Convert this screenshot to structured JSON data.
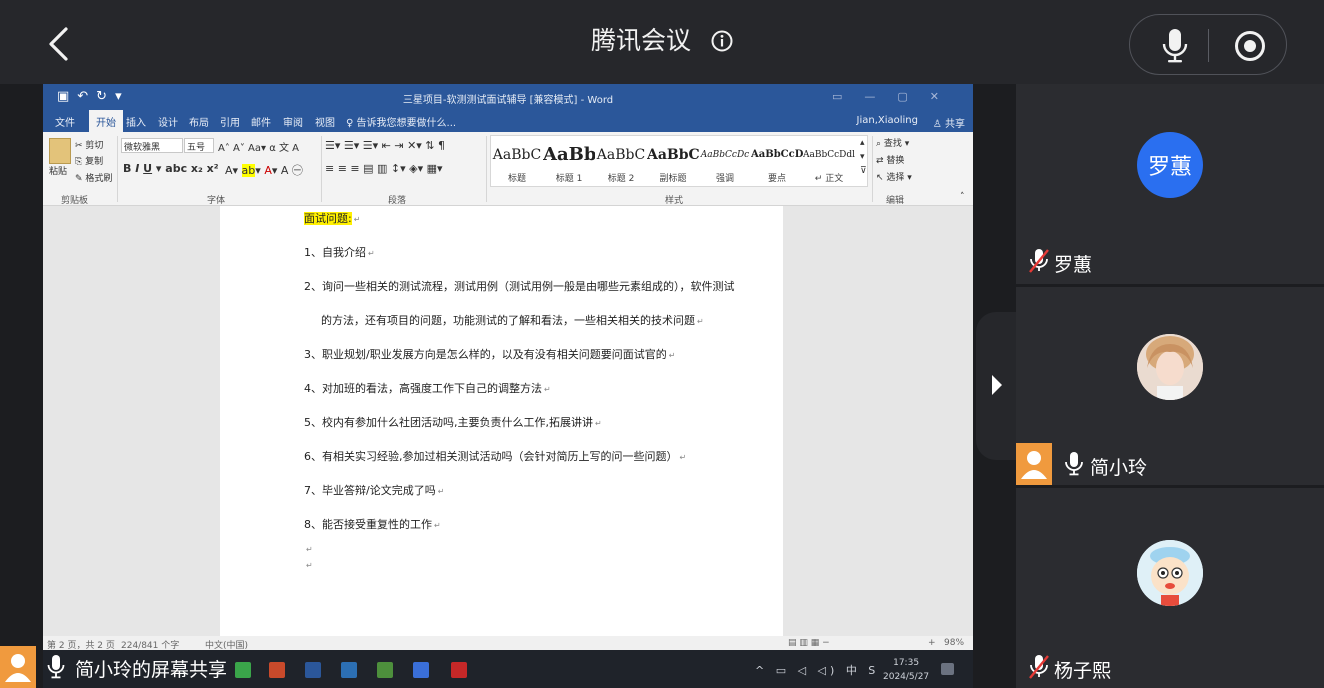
{
  "topbar": {
    "title": "腾讯会议"
  },
  "word": {
    "doc_title": "三星项目-软测测试面试辅导 [兼容模式] - Word",
    "tabs": [
      "文件",
      "开始",
      "插入",
      "设计",
      "布局",
      "引用",
      "邮件",
      "审阅",
      "视图"
    ],
    "tell_me": "告诉我您想要做什么...",
    "user": "Jian,Xiaoling",
    "share_label": "共享",
    "clipboard": {
      "paste": "粘贴",
      "cut": "剪切",
      "copy": "复制",
      "format_painter": "格式刷",
      "group": "剪贴板"
    },
    "font": {
      "name": "微软雅黑",
      "size": "五号",
      "group": "字体"
    },
    "paragraph_group": "段落",
    "styles": [
      {
        "sample": "AaBbC",
        "name": "标题"
      },
      {
        "sample": "AaBb",
        "name": "标题 1"
      },
      {
        "sample": "AaBbC",
        "name": "标题 2"
      },
      {
        "sample": "AaBbC",
        "name": "副标题"
      },
      {
        "sample": "AaBbCcDc",
        "name": "强调"
      },
      {
        "sample": "AaBbCcD",
        "name": "要点"
      },
      {
        "sample": "AaBbCcDdl",
        "name": "↵ 正文"
      }
    ],
    "styles_group": "样式",
    "editing": {
      "find": "查找",
      "replace": "替换",
      "select": "选择",
      "group": "编辑"
    },
    "doc_lines": [
      "面试问题:",
      "1、自我介绍",
      "2、询问一些相关的测试流程，测试用例（测试用例一般是由哪些元素组成的），软件测试",
      "的方法，还有项目的问题，功能测试的了解和看法，一些相关相关的技术问题",
      "3、职业规划/职业发展方向是怎么样的，以及有没有相关问题要问面试官的",
      "4、对加班的看法，高强度工作下自己的调整方法",
      "5、校内有参加什么社团活动吗,主要负责什么工作,拓展讲讲",
      "6、有相关实习经验,参加过相关测试活动吗（会针对简历上写的问一些问题）",
      "7、毕业答辩/论文完成了吗",
      "8、能否接受重复性的工作"
    ],
    "status": {
      "page": "第 2 页，共 2 页",
      "words": "224/841 个字",
      "lang": "中文(中国)",
      "zoom": "98%"
    }
  },
  "taskbar": {
    "time": "17:35",
    "date": "2024/5/27",
    "ime": "中"
  },
  "share_label": "简小玲的屏幕共享",
  "participants": [
    {
      "name": "罗蕙",
      "avatar_text": "罗蕙",
      "muted": true
    },
    {
      "name": "简小玲",
      "muted": false,
      "sharing": true
    },
    {
      "name": "杨子熙",
      "muted": true
    }
  ],
  "colors": {
    "word_blue": "#2b579a",
    "badge_orange": "#f09a3e",
    "avatar_blue": "#2a6ff0",
    "highlight": "#fff000"
  }
}
